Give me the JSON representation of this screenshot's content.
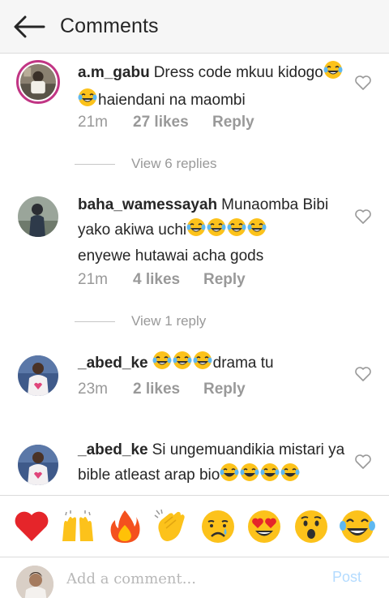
{
  "header": {
    "title": "Comments",
    "back_icon": "arrow-left-icon"
  },
  "comments": [
    {
      "username": "a.m_gabu",
      "text_before": "Dress code mkuu kidogo",
      "emoji_count": 2,
      "text_after": "haiendani na maombi",
      "time": "21m",
      "likes": "27 likes",
      "reply": "Reply",
      "view_replies": "View 6 replies"
    },
    {
      "username": "baha_wamessayah",
      "text_before": "Munaomba Bibi yako akiwa uchi",
      "emoji_count": 4,
      "text_after": "enyewe hutawai acha gods",
      "time": "21m",
      "likes": "4 likes",
      "reply": "Reply",
      "view_replies": "View 1 reply"
    },
    {
      "username": "_abed_ke",
      "text_before": "",
      "emoji_count": 3,
      "text_after": "drama tu",
      "time": "23m",
      "likes": "2 likes",
      "reply": "Reply"
    },
    {
      "username": "_abed_ke",
      "text_before": "Si ungemuandikia mistari ya bible atleast arap bio",
      "emoji_count": 4,
      "text_after": ""
    }
  ],
  "emoji_bar": [
    "red-heart",
    "raising-hands",
    "fire",
    "clapping-hands",
    "crying-face",
    "heart-eyes",
    "surprised-face",
    "tears-of-joy"
  ],
  "input": {
    "placeholder": "Add a comment...",
    "post_label": "Post"
  },
  "colors": {
    "post_disabled": "#b3dbff",
    "meta_gray": "#999999",
    "story_ring": "#c13584"
  }
}
